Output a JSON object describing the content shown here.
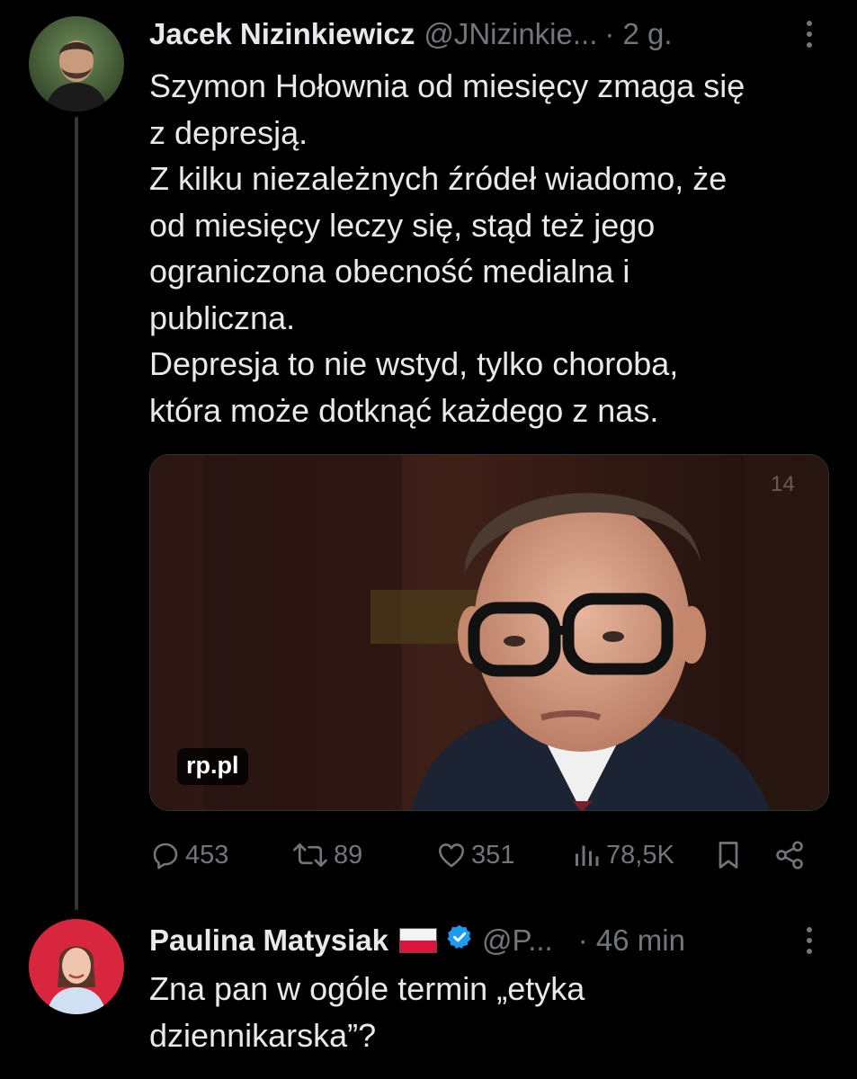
{
  "colors": {
    "background": "#000000",
    "primary_text": "#e7e9ea",
    "secondary_text": "#71767b",
    "thread_line": "#333639",
    "verified_badge": "#1d9bf0"
  },
  "tweet": {
    "author_name": "Jacek Nizinkiewicz",
    "handle": "@JNizinkie...",
    "time": "· 2 g.",
    "text": "Szymon Hołownia od miesięcy zmaga się\nz depresją.\nZ kilku niezależnych źródeł wiadomo, że\nod miesięcy leczy się, stąd też jego\nograniczona obecność medialna i\npubliczna.\nDepresja to nie wstyd, tylko choroba,\nktóra może dotknąć każdego z nas.",
    "media": {
      "source_label": "rp.pl",
      "top_right_text": "14"
    },
    "actions": {
      "replies": "453",
      "retweets": "89",
      "likes": "351",
      "views": "78,5K"
    }
  },
  "reply": {
    "author_name": "Paulina Matysiak",
    "handle": "@P...",
    "time": "· 46 min",
    "text": "Zna pan w ogóle termin „etyka\ndziennikarska”?",
    "verified": true,
    "flag": "poland-flag-icon"
  }
}
